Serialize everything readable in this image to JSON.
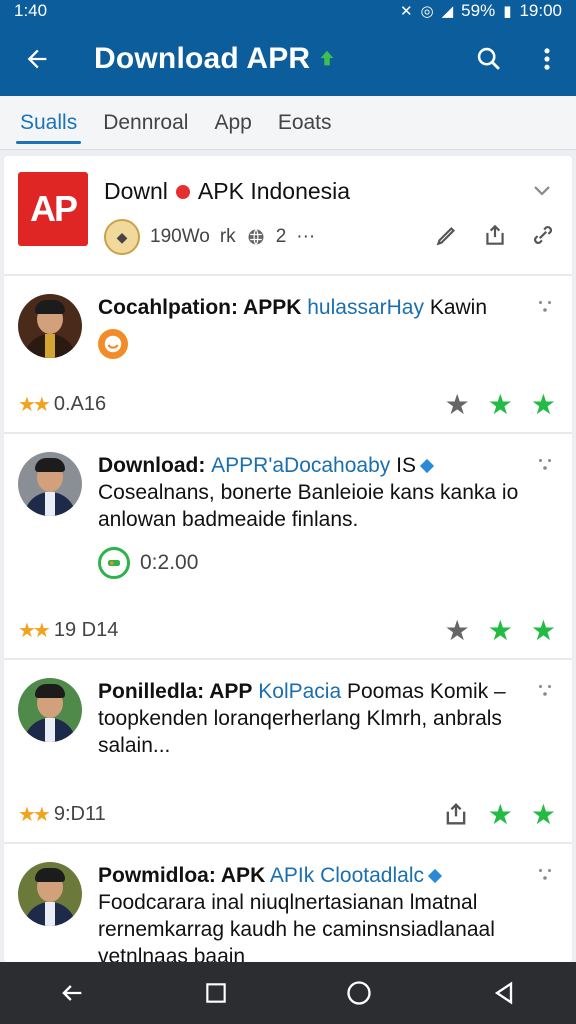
{
  "status_bar": {
    "left_time": "1:40",
    "battery": "59%",
    "clock": "19:00"
  },
  "app_bar": {
    "title": "Download APR"
  },
  "tabs": [
    {
      "label": "Sualls",
      "active": true
    },
    {
      "label": "Dennroal",
      "active": false
    },
    {
      "label": "App",
      "active": false
    },
    {
      "label": "Eoats",
      "active": false
    }
  ],
  "app_header": {
    "logo_text": "AP",
    "name_prefix": "Downl",
    "name_suffix": "APK Indonesia",
    "meta_count": "190Wo",
    "meta_text": "rk",
    "meta_number": "2",
    "more": "···"
  },
  "posts": [
    {
      "title_bold": "Cocahlpation: APPK",
      "title_link": "hulassarHay",
      "title_rest": "Kawin",
      "desc": "",
      "rating": "0.A16"
    },
    {
      "title_bold": "Download: ",
      "title_link": "APPR'aDocahoaby",
      "title_rest": "IS",
      "desc": "Cosealnans, bonerte Banleioie kans kanka io anlowan badmeaide finlans.",
      "reaction_value": "0:2.00",
      "rating": "19 D14"
    },
    {
      "title_bold": "Ponilledla: APP",
      "title_link": "KolPacia",
      "title_rest": "Poomas Komik –",
      "desc": "toopkenden loranqerherlang Klmrh, anbrals salain...",
      "rating": "9:D11"
    },
    {
      "title_bold": "Powmidloa: APK",
      "title_link": "APIk Clootadlalc",
      "title_rest": "",
      "desc": "Foodcarara inal niuqlnertasianan lmatnal rernemkarrag kaudh he caminsnsiadlanaal vetnlnaas baain"
    }
  ],
  "colors": {
    "primary": "#0b5d9c",
    "accent": "#1c73b8",
    "star_orange": "#f2a21c",
    "star_green": "#22bb44",
    "logo_red": "#e02525"
  }
}
